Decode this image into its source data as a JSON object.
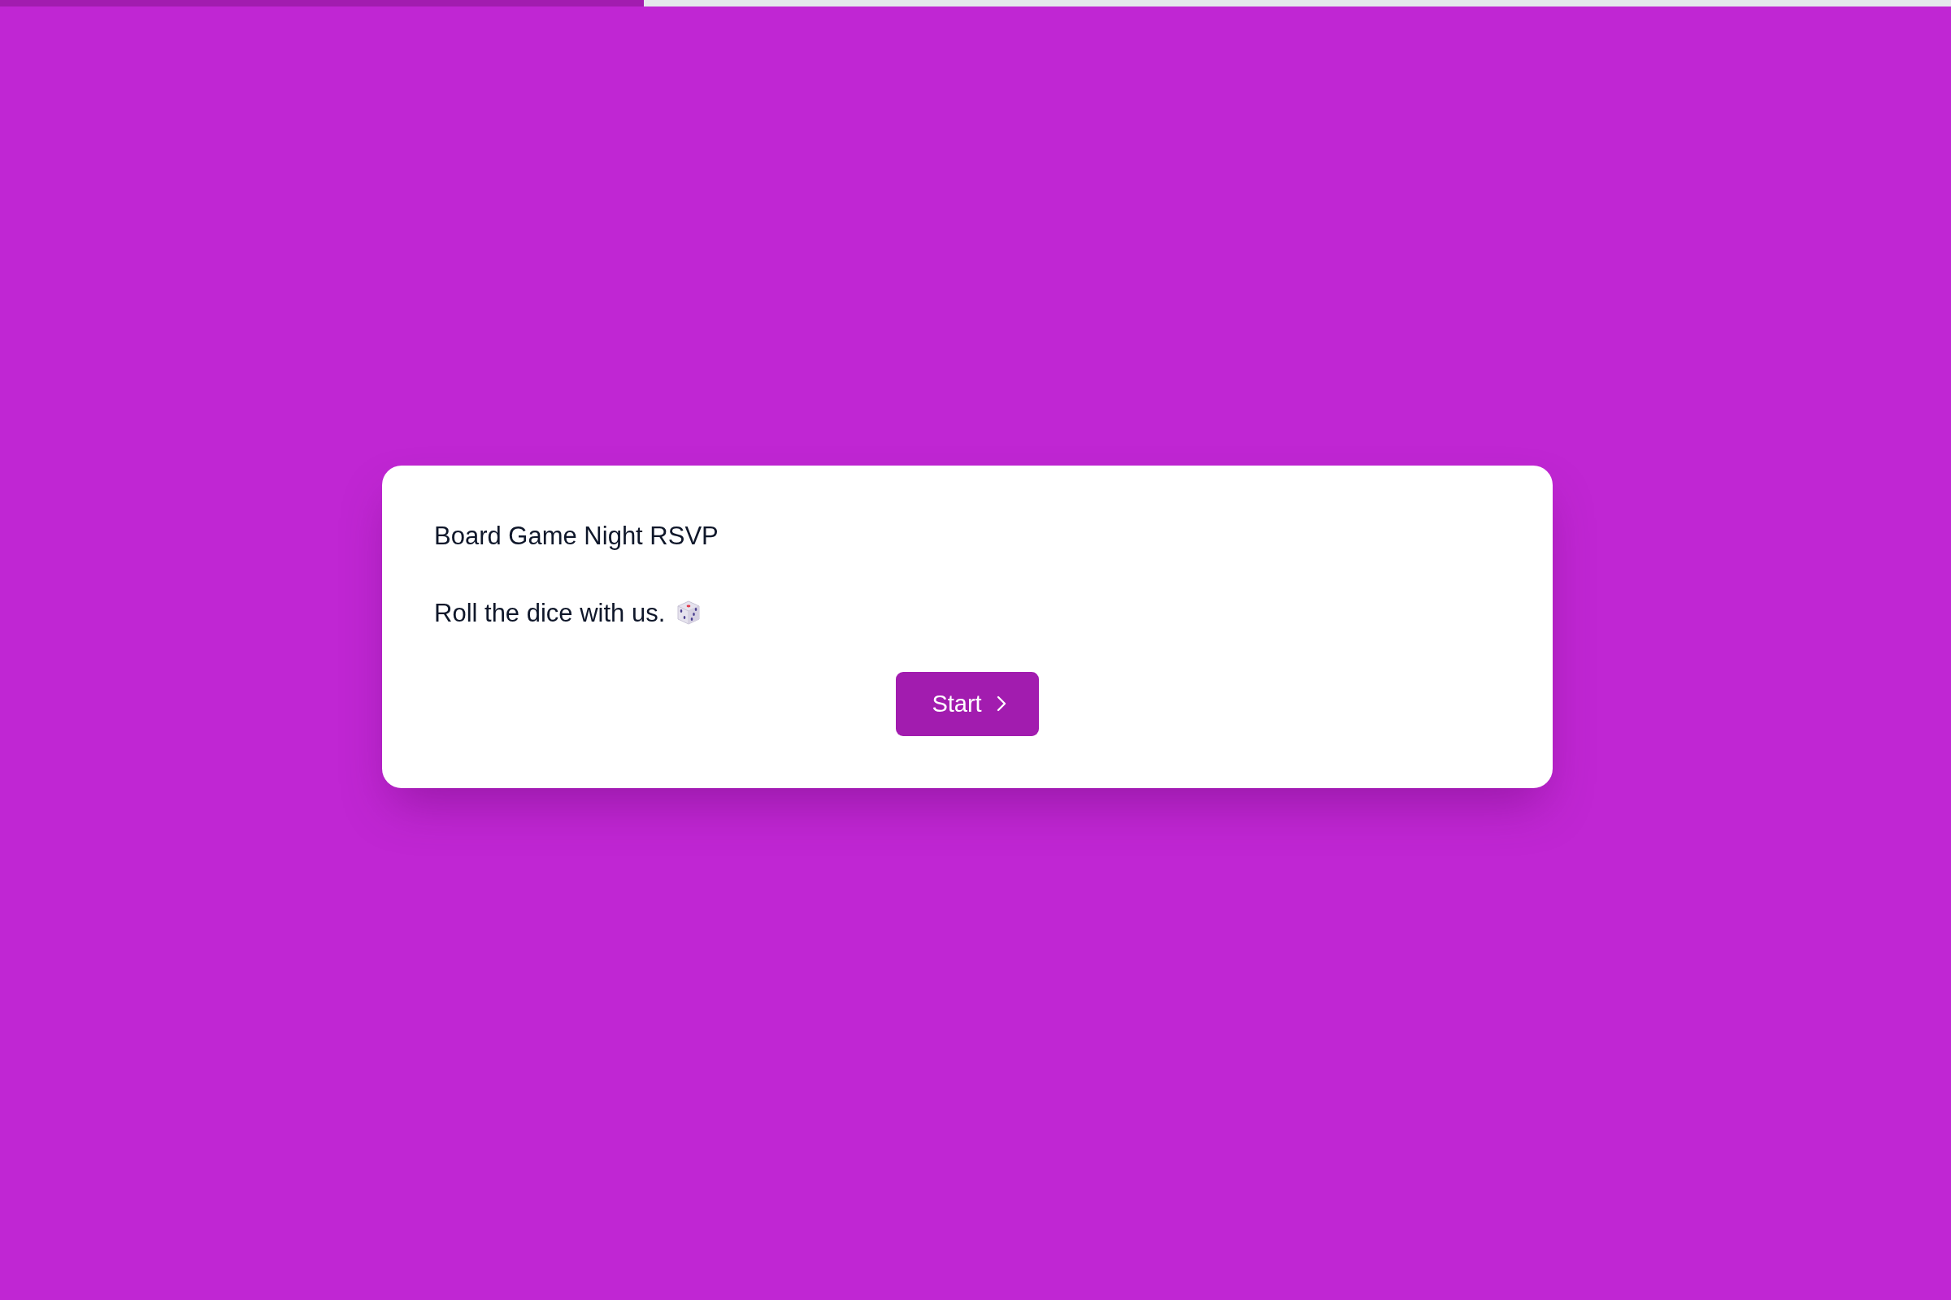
{
  "progress": {
    "level": 0.33
  },
  "card": {
    "title": "Board Game Night RSVP",
    "subtitle": "Roll the dice with us.",
    "button": {
      "label": "Start"
    }
  }
}
